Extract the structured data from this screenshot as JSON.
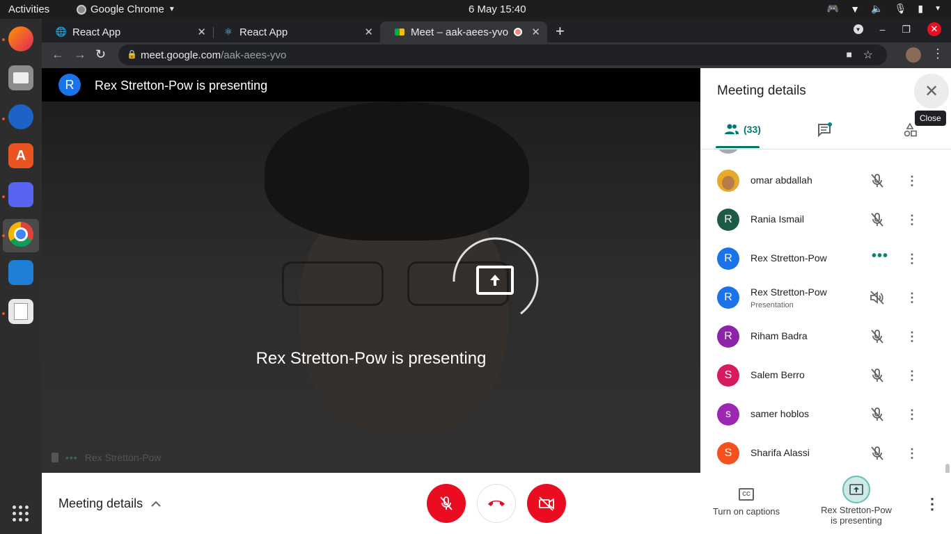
{
  "os": {
    "activities": "Activities",
    "app_name": "Google Chrome",
    "clock": "6 May  15:40"
  },
  "browser": {
    "tabs": [
      {
        "title": "React App",
        "active": false
      },
      {
        "title": "React App",
        "active": false
      },
      {
        "title": "Meet – aak-aees-yvo",
        "active": true
      }
    ],
    "url_host": "meet.google.com",
    "url_path": "/aak-aees-yvo"
  },
  "meet": {
    "presenting_banner": "Rex Stretton-Pow is presenting",
    "presenter_initial": "R",
    "overlay_text": "Rex Stretton-Pow is presenting",
    "tile_name": "Rex Stretton-Pow"
  },
  "panel": {
    "title": "Meeting details",
    "close_tooltip": "Close",
    "people_count": "(33)",
    "participants": [
      {
        "initial": "",
        "name": "omar abdallah",
        "color": "#e8a92a",
        "mic": "muted",
        "photo": true
      },
      {
        "initial": "R",
        "name": "Rania Ismail",
        "color": "#1e5b45",
        "mic": "muted"
      },
      {
        "initial": "R",
        "name": "Rex Stretton-Pow",
        "color": "#1a73e8",
        "mic": "talking"
      },
      {
        "initial": "R",
        "name": "Rex Stretton-Pow",
        "sub": "Presentation",
        "color": "#1a73e8",
        "mic": "volume-off"
      },
      {
        "initial": "R",
        "name": "Riham Badra",
        "color": "#8e24aa",
        "mic": "muted"
      },
      {
        "initial": "S",
        "name": "Salem Berro",
        "color": "#d81b60",
        "mic": "muted"
      },
      {
        "initial": "s",
        "name": "samer hoblos",
        "color": "#9c27b0",
        "mic": "muted"
      },
      {
        "initial": "S",
        "name": "Sharifa Alassi",
        "color": "#f4511e",
        "mic": "muted"
      }
    ]
  },
  "bottom": {
    "meeting_details": "Meeting details",
    "captions": "Turn on captions",
    "presenting_line1": "Rex Stretton-Pow",
    "presenting_line2": "is presenting"
  },
  "colors": {
    "accent": "#00796b",
    "danger": "#ea0c20",
    "presenter_blue": "#1a73e8"
  }
}
